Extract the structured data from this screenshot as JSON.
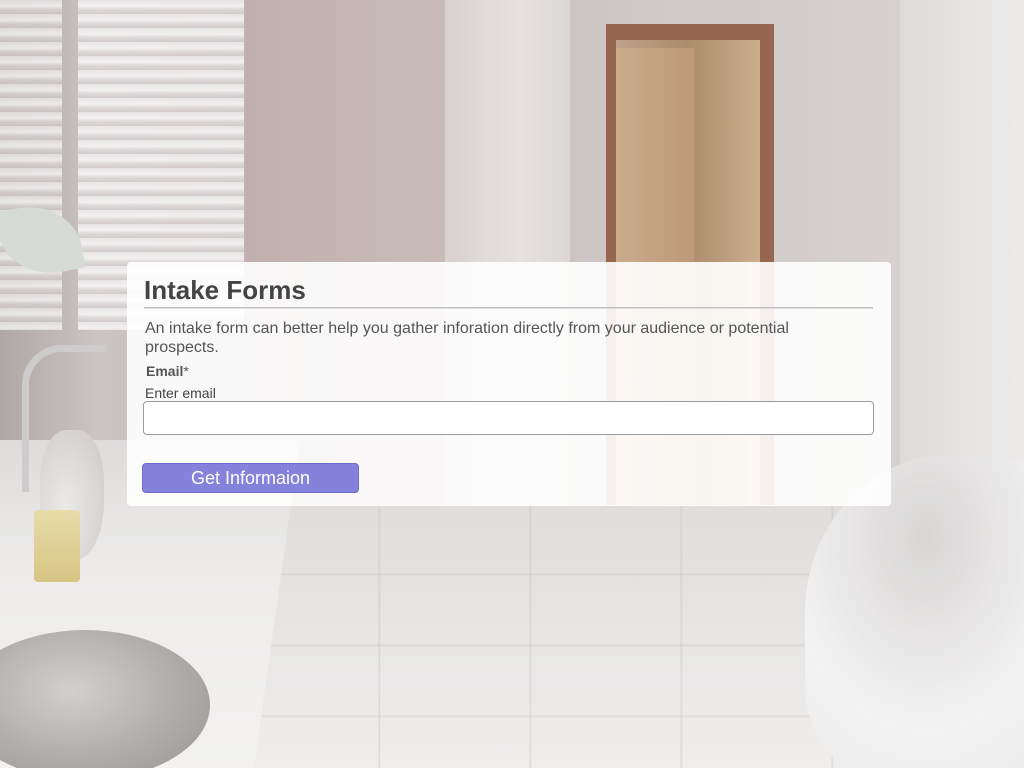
{
  "form": {
    "title": "Intake Forms",
    "description": "An intake form can better help you gather inforation directly from your audience or potential prospects.",
    "email_label": "Email",
    "email_required_marker": "*",
    "email_placeholder_label": "Enter email",
    "email_value": "",
    "submit_label": "Get Informaion"
  },
  "colors": {
    "button_background": "#8482db",
    "title_text": "#444444",
    "card_background": "#ffffffe6"
  }
}
